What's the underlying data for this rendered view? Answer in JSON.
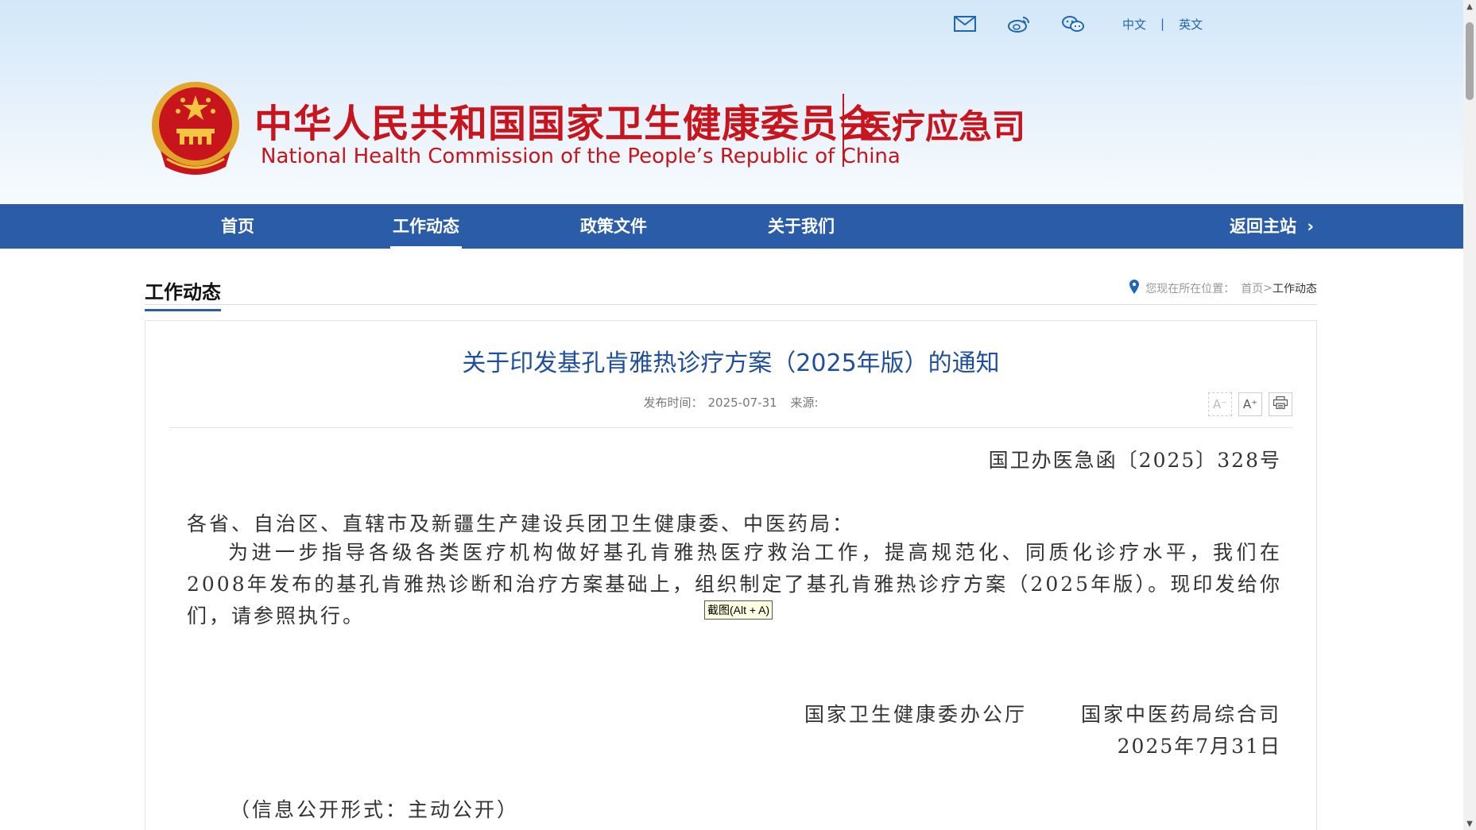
{
  "header": {
    "top_links": {
      "icons": [
        "mail-icon",
        "weibo-icon",
        "wechat-icon"
      ],
      "lang_cn": "中文",
      "separator": "|",
      "lang_en": "英文"
    },
    "title_cn": "中华人民共和国国家卫生健康委员会",
    "title_en": "National Health Commission of the People’s  Republic of China",
    "department": "医疗应急司",
    "brand_color": "#c8141c"
  },
  "nav": {
    "items": [
      {
        "label": "首页"
      },
      {
        "label": "工作动态",
        "active": true
      },
      {
        "label": "政策文件"
      },
      {
        "label": "关于我们"
      }
    ],
    "back_label": "返回主站",
    "back_chevron": "›",
    "bg_color": "#2a5ca8"
  },
  "section": {
    "title": "工作动态",
    "breadcrumb": {
      "prefix": "您现在所在位置：",
      "home": "首页",
      "sep": ">",
      "current": "工作动态"
    }
  },
  "article": {
    "title": "关于印发基孔肯雅热诊疗方案（2025年版）的通知",
    "meta": {
      "publish_label": "发布时间：",
      "publish_date": "2025-07-31",
      "source_label": "来源:"
    },
    "tools": {
      "font_decrease": "A⁻",
      "font_increase": "A⁺"
    },
    "doc_number": "国卫办医急函〔2025〕328号",
    "addressee": "各省、自治区、直辖市及新疆生产建设兵团卫生健康委、中医药局：",
    "body": "为进一步指导各级各类医疗机构做好基孔肯雅热医疗救治工作，提高规范化、同质化诊疗水平，我们在2008年发布的基孔肯雅热诊断和治疗方案基础上，组织制定了基孔肯雅热诊疗方案（2025年版）。现印发给你们，请参照执行。",
    "signer_1": "国家卫生健康委办公厅",
    "signer_2": "国家中医药局综合司",
    "sign_date": "2025年7月31日",
    "disclosure": "（信息公开形式：主动公开）"
  },
  "tooltip": "截图(Alt + A)",
  "scrollbar": {
    "up": "▲",
    "down": "▼"
  }
}
